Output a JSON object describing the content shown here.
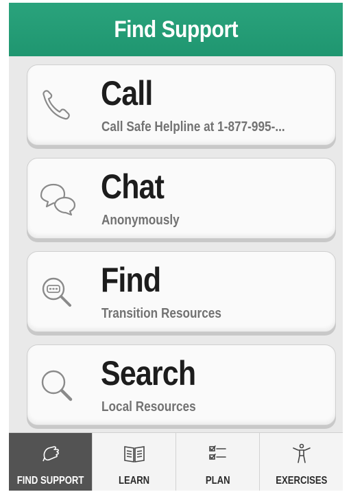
{
  "header": {
    "title": "Find Support"
  },
  "cards": [
    {
      "icon": "phone-icon",
      "title": "Call",
      "subtitle": "Call Safe Helpline at 1-877-995-..."
    },
    {
      "icon": "chat-bubbles-icon",
      "title": "Chat",
      "subtitle": "Anonymously"
    },
    {
      "icon": "magnifier-chat-icon",
      "title": "Find",
      "subtitle": "Transition Resources"
    },
    {
      "icon": "search-icon",
      "title": "Search",
      "subtitle": "Local Resources"
    }
  ],
  "tabs": [
    {
      "icon": "hand-icon",
      "label": "FIND SUPPORT",
      "active": true
    },
    {
      "icon": "book-icon",
      "label": "LEARN",
      "active": false
    },
    {
      "icon": "checklist-icon",
      "label": "PLAN",
      "active": false
    },
    {
      "icon": "stretch-figure-icon",
      "label": "EXERCISES",
      "active": false
    }
  ],
  "colors": {
    "header": "#1f9670",
    "active_tab": "#535353",
    "card_bg": "#fafafa"
  }
}
